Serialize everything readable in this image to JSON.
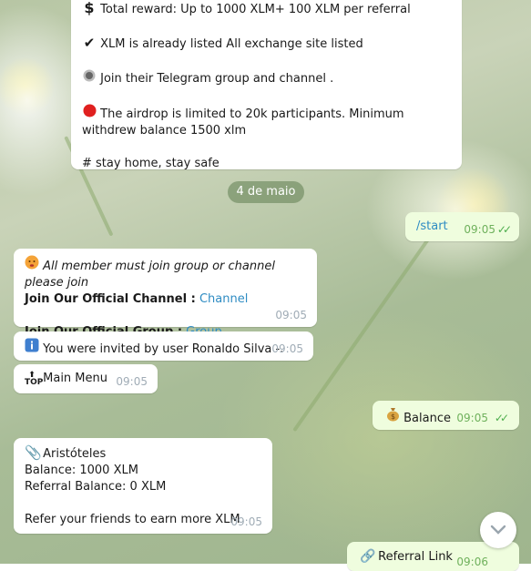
{
  "chat": {
    "top_message": {
      "line1_icon": "dollar-icon",
      "line1": "Total reward: Up to 1000 XLM+ 100 XLM per referral",
      "line2_icon": "checkmark-icon",
      "line2": "XLM is already listed All exchange site listed",
      "line3_icon": "radio-button-icon",
      "line3": "Join their Telegram group and channel .",
      "line4_icon": "red-circle-icon",
      "line4": "The airdrop is limited to 20k participants. Minimum withdrew balance 1500 xlm",
      "line5": "# stay home, stay safe"
    },
    "date_separator": "4 de maio",
    "start_message": {
      "text": "/start",
      "time": "09:05"
    },
    "join_message": {
      "icon": "hot-face-emoji-icon",
      "line1": "All member must join group or channel please join",
      "channel_label": "Join Our Official Channel :",
      "channel_link": "Channel",
      "group_label": "Join Our Official Group :",
      "group_link": "Group",
      "time": "09:05"
    },
    "invite_message": {
      "icon": "info-icon",
      "text": "You were invited by user Ronaldo Silva -.",
      "time": "09:05"
    },
    "menu_message": {
      "icon": "top-arrow-icon",
      "text": "Main Menu",
      "time": "09:05"
    },
    "balance_message": {
      "icon": "money-bag-icon",
      "text": "Balance",
      "time": "09:05"
    },
    "account_message": {
      "icon": "paperclip-icon",
      "name": "Aristóteles",
      "balance": "Balance: 1000 XLM",
      "referral_balance": "Referral Balance: 0 XLM",
      "refer_text": "Refer your friends to earn more XLM",
      "time": "09:05"
    },
    "referral_message": {
      "icon": "link-icon",
      "text": "Referral Link",
      "time": "09:06"
    }
  },
  "colors": {
    "accent_link": "#2f8cc3",
    "outgoing_bubble": "#effdde",
    "read_ticks": "#4fae4e"
  }
}
